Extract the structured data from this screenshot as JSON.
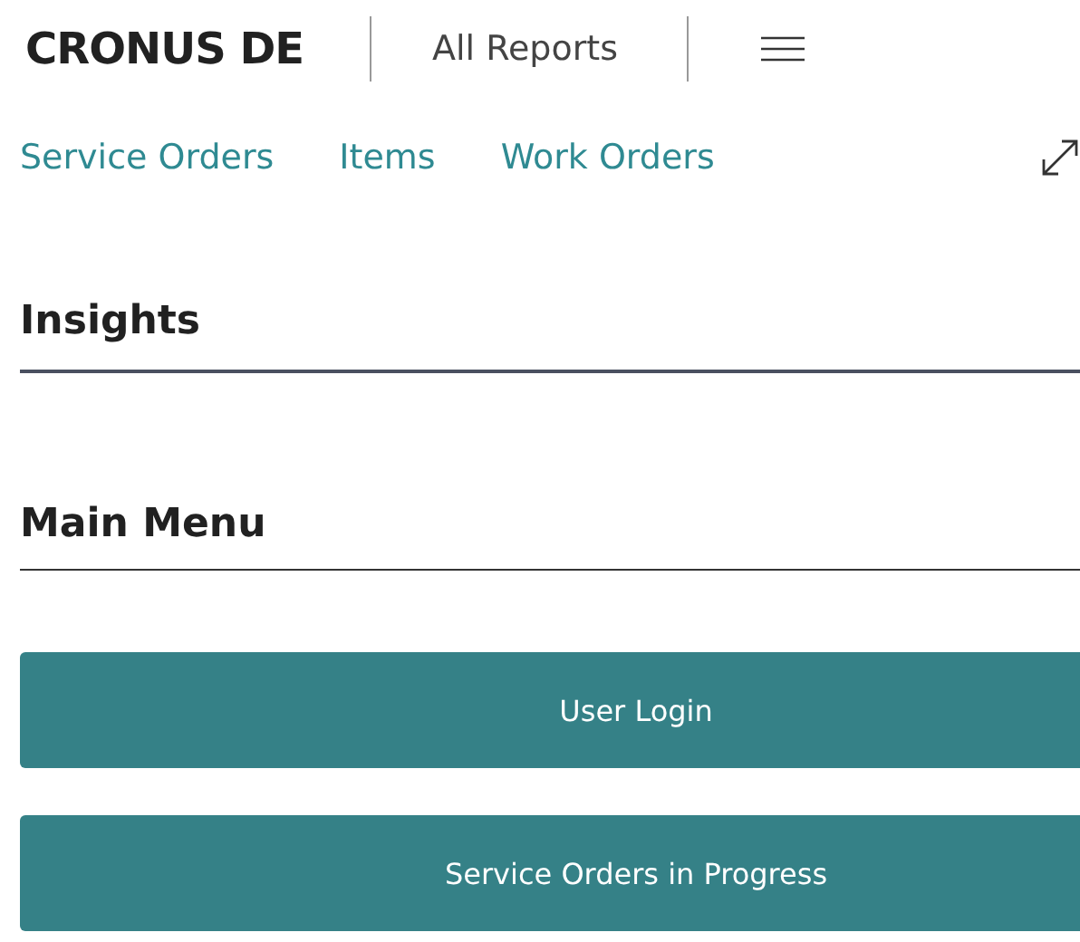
{
  "header": {
    "company": "CRONUS DE",
    "reports_link": "All Reports"
  },
  "nav": {
    "links": [
      "Service Orders",
      "Items",
      "Work Orders"
    ]
  },
  "sections": [
    {
      "title": "Insights"
    },
    {
      "title": "Main Menu"
    }
  ],
  "menu_buttons": [
    "User Login",
    "Service Orders in Progress"
  ]
}
